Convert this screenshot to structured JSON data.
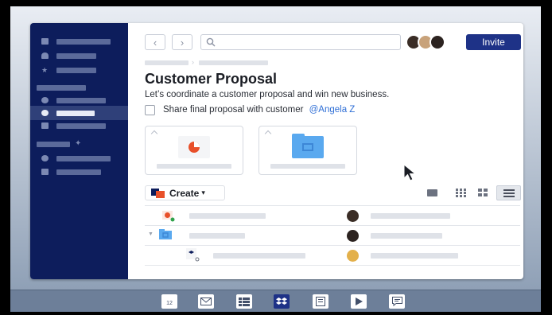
{
  "header": {
    "back_label": "‹",
    "forward_label": "›",
    "search_icon": "search-icon",
    "invite_label": "Invite"
  },
  "page": {
    "title": "Customer Proposal",
    "subtitle": "Let’s coordinate a customer proposal and win new business.",
    "task_text": "Share final proposal with customer",
    "task_mention": "@Angela Z"
  },
  "toolbar": {
    "create_label": "Create"
  },
  "colors": {
    "sidebar": "#0d1d5c",
    "accent": "#1e3287",
    "mention": "#2f6fd6",
    "folder": "#5aa9ef",
    "pie": "#e8502a"
  },
  "taskbar": {
    "calendar_day": "12"
  }
}
